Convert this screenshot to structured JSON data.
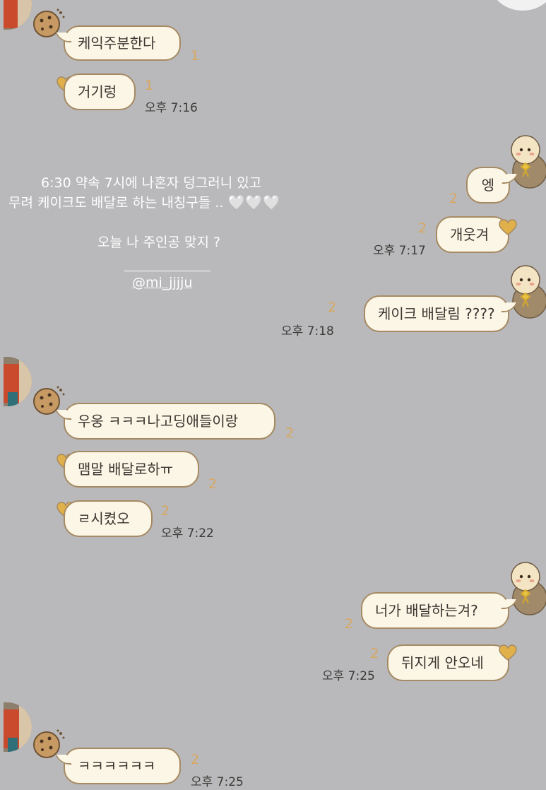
{
  "messages": {
    "m1": {
      "text": "케익주분한다",
      "unread": "1"
    },
    "m2": {
      "text": "거기렁",
      "unread": "1",
      "time": "오후 7:16"
    },
    "m3": {
      "text": "엥",
      "unread": "2"
    },
    "m4": {
      "text": "개웃겨",
      "unread": "2",
      "time": "오후 7:17"
    },
    "m5": {
      "text": "케이크 배달림 ????",
      "unread": "2",
      "time": "오후 7:18"
    },
    "m6": {
      "text": "우웅 ㅋㅋㅋ나고딩애들이랑",
      "unread": "2"
    },
    "m7": {
      "text": "맴말 배달로하ㅠ",
      "unread": "2"
    },
    "m8": {
      "text": "ㄹ시켰오",
      "unread": "2",
      "time": "오후 7:22"
    },
    "m9": {
      "text": "너가 배달하는겨?",
      "unread": "2"
    },
    "m10": {
      "text": "뒤지게 안오네",
      "unread": "2",
      "time": "오후 7:25"
    },
    "m11": {
      "text": "ㅋㅋㅋㅋㅋㅋ",
      "unread": "2",
      "time": "오후 7:25"
    }
  },
  "story_overlay": {
    "line1": "6:30 약속 7시에 나혼자 덩그러니 있고",
    "line2": "무려 케이크도 배달로 하는 내칭구들 ..",
    "hearts": "🤍🤍🤍",
    "line3": "오늘 나 주인공 맞지 ?",
    "mention": "@mi_jjjju"
  },
  "colors": {
    "background": "#b9b9bb",
    "bubble_fill": "#fbf6e6",
    "bubble_border": "#a68a63",
    "unread": "#d9a75e",
    "heart": "#e0b04a",
    "cookie": "#c79a63"
  },
  "icons": [
    "cookie-icon",
    "heart-icon",
    "doll-avatar-icon",
    "profile-photo"
  ]
}
